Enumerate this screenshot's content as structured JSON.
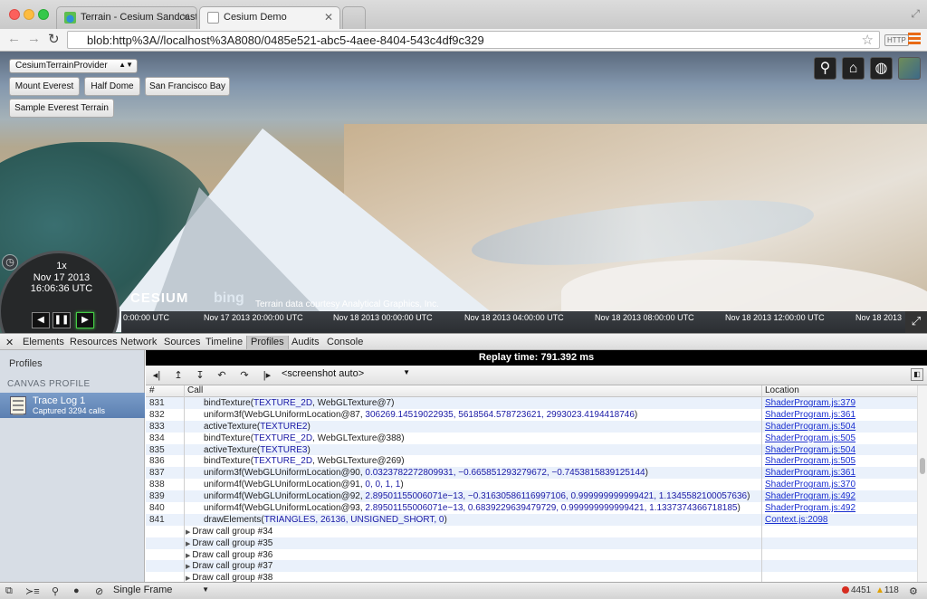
{
  "browser": {
    "tabs": [
      {
        "title": "Terrain - Cesium Sandcast"
      },
      {
        "title": "Cesium Demo"
      }
    ],
    "url": "blob:http%3A//localhost%3A8080/0485e521-abc5-4aee-8404-543c4df9c329",
    "ext_label": "HTTP"
  },
  "viewer": {
    "provider_select": "CesiumTerrainProvider",
    "buttons": [
      "Mount Everest",
      "Half Dome",
      "San Francisco Bay",
      "Sample Everest Terrain"
    ],
    "animation": {
      "speed": "1x",
      "date": "Nov 17 2013",
      "time": "16:06:36 UTC"
    },
    "logo": "CESIUM",
    "bing": "bing",
    "credit": "Terrain data courtesy Analytical Graphics, Inc.",
    "timeline_ticks": [
      "0:00:00 UTC",
      "Nov 17 2013 20:00:00 UTC",
      "Nov 18 2013 00:00:00 UTC",
      "Nov 18 2013 04:00:00 UTC",
      "Nov 18 2013 08:00:00 UTC",
      "Nov 18 2013 12:00:00 UTC",
      "Nov 18 2013"
    ]
  },
  "devtools": {
    "tabs": [
      "Elements",
      "Resources",
      "Network",
      "Sources",
      "Timeline",
      "Profiles",
      "Audits",
      "Console"
    ],
    "active_tab": "Profiles",
    "sidebar": {
      "title": "Profiles",
      "category": "CANVAS PROFILE",
      "item_title": "Trace Log 1",
      "item_subtitle": "Captured 3294 calls"
    },
    "replay_time": "Replay time: 791.392 ms",
    "screenshot_select": "<screenshot auto>",
    "columns": {
      "num": "#",
      "call": "Call",
      "location": "Location"
    },
    "rows": [
      {
        "n": "831",
        "fn": "bindTexture(",
        "args": "TEXTURE_2D",
        "rest": ", WebGLTexture@7)",
        "loc": "ShaderProgram.js:379"
      },
      {
        "n": "832",
        "fn": "uniform3f(WebGLUniformLocation@87, ",
        "args": "306269.14519022935, 5618564.578723621, 2993023.4194418746",
        "rest": ")",
        "loc": "ShaderProgram.js:361"
      },
      {
        "n": "833",
        "fn": "activeTexture(",
        "args": "TEXTURE2",
        "rest": ")",
        "loc": "ShaderProgram.js:504"
      },
      {
        "n": "834",
        "fn": "bindTexture(",
        "args": "TEXTURE_2D",
        "rest": ", WebGLTexture@388)",
        "loc": "ShaderProgram.js:505"
      },
      {
        "n": "835",
        "fn": "activeTexture(",
        "args": "TEXTURE3",
        "rest": ")",
        "loc": "ShaderProgram.js:504"
      },
      {
        "n": "836",
        "fn": "bindTexture(",
        "args": "TEXTURE_2D",
        "rest": ", WebGLTexture@269)",
        "loc": "ShaderProgram.js:505"
      },
      {
        "n": "837",
        "fn": "uniform3f(WebGLUniformLocation@90, ",
        "args": "0.0323782272809931, −0.665851293279672, −0.7453815839125144",
        "rest": ")",
        "loc": "ShaderProgram.js:361"
      },
      {
        "n": "838",
        "fn": "uniform4f(WebGLUniformLocation@91, ",
        "args": "0, 0, 1, 1",
        "rest": ")",
        "loc": "ShaderProgram.js:370"
      },
      {
        "n": "839",
        "fn": "uniform4f(WebGLUniformLocation@92, ",
        "args": "2.89501155006071e−13, −0.31630586116997106, 0.999999999999421, 1.1345582100057636",
        "rest": ")",
        "loc": "ShaderProgram.js:492"
      },
      {
        "n": "840",
        "fn": "uniform4f(WebGLUniformLocation@93, ",
        "args": "2.89501155006071e−13, 0.6839229639479729, 0.999999999999421, 1.1337374366718185",
        "rest": ")",
        "loc": "ShaderProgram.js:492"
      },
      {
        "n": "841",
        "fn": "drawElements(",
        "args": "TRIANGLES, 26136, UNSIGNED_SHORT, 0",
        "rest": ")",
        "loc": "Context.js:2098"
      }
    ],
    "groups": [
      "Draw call group #34",
      "Draw call group #35",
      "Draw call group #36",
      "Draw call group #37",
      "Draw call group #38"
    ],
    "status": {
      "frame_select": "Single Frame",
      "errors": "4451",
      "warnings": "118"
    }
  }
}
